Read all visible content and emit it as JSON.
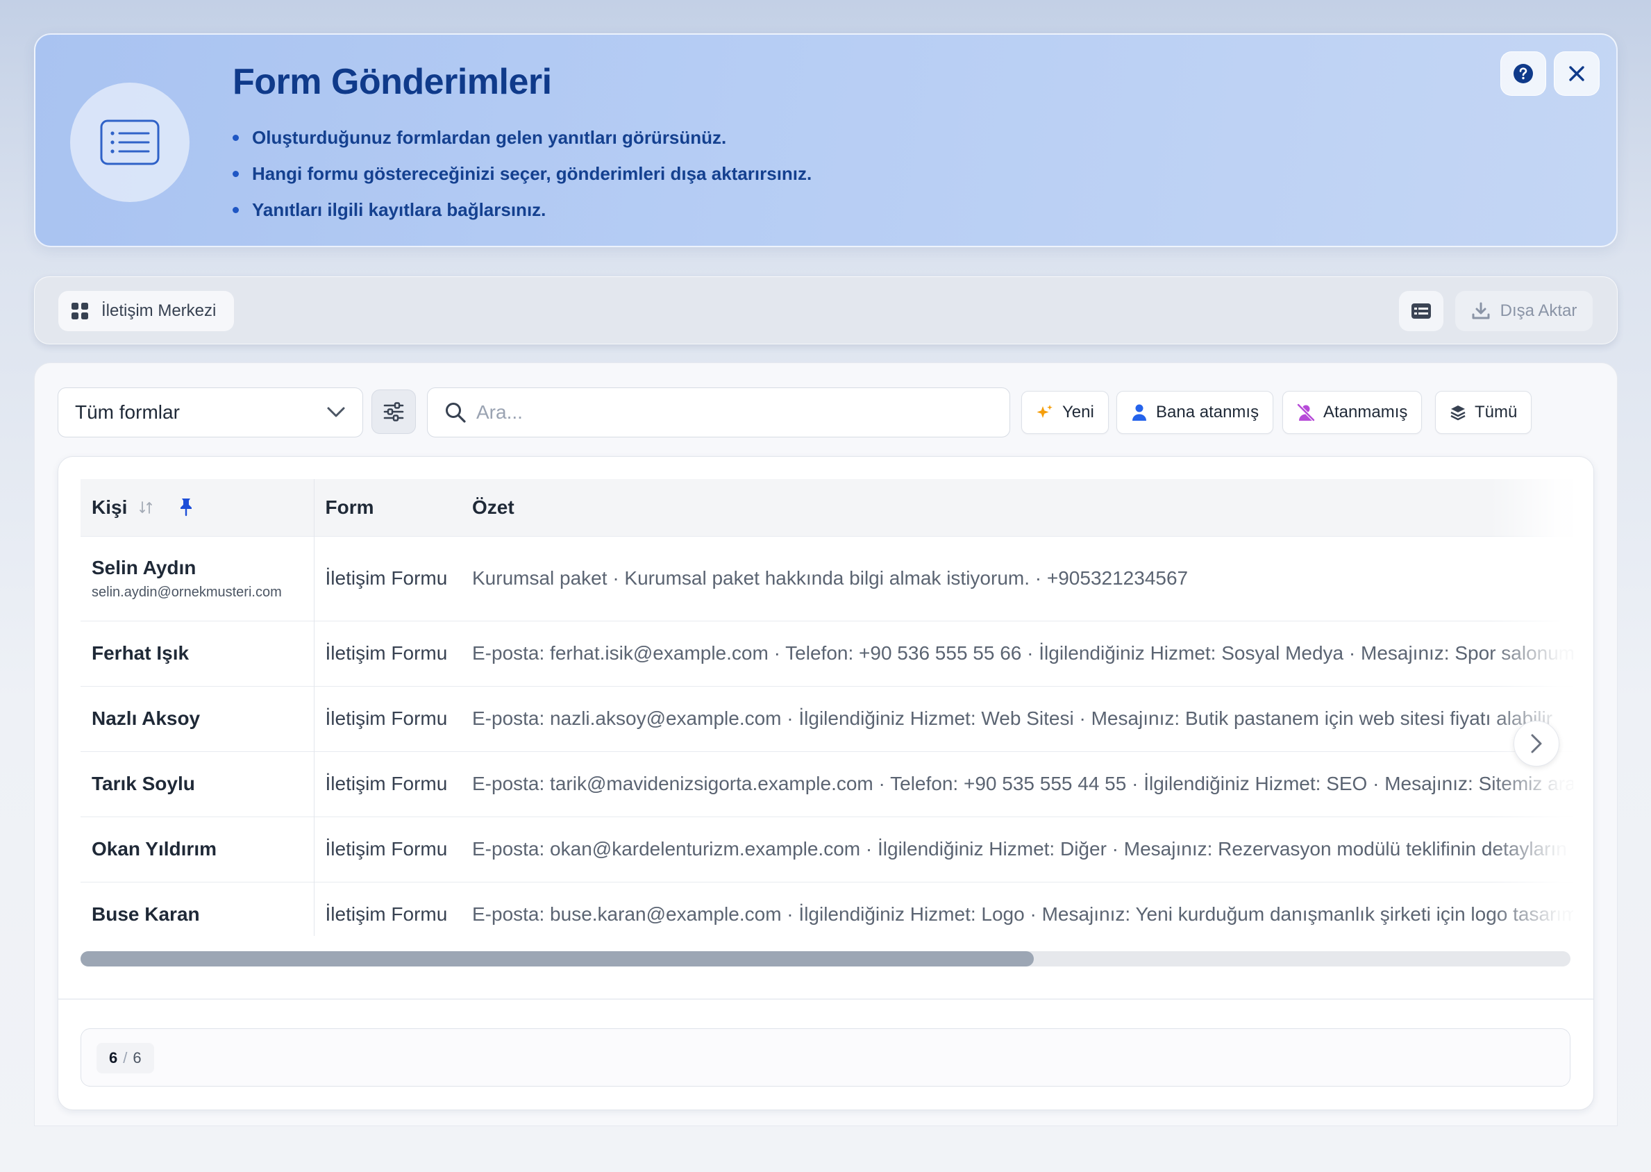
{
  "hero": {
    "title": "Form Gönderimleri",
    "bullets": [
      "Oluşturduğunuz formlardan gelen yanıtları görürsünüz.",
      "Hangi formu göstereceğinizi seçer, gönderimleri dışa aktarırsınız.",
      "Yanıtları ilgili kayıtlara bağlarsınız."
    ]
  },
  "toolbar": {
    "breadcrumb": "İletişim Merkezi",
    "export_label": "Dışa Aktar"
  },
  "filters": {
    "form_select": "Tüm formlar",
    "search_placeholder": "Ara...",
    "chips": {
      "new": "Yeni",
      "assigned_to_me": "Bana atanmış",
      "unassigned": "Atanmamış",
      "all": "Tümü"
    }
  },
  "table": {
    "headers": {
      "person": "Kişi",
      "form": "Form",
      "summary": "Özet"
    },
    "rows": [
      {
        "name": "Selin Aydın",
        "email": "selin.aydin@ornekmusteri.com",
        "form": "İletişim Formu",
        "summary": "Kurumsal paket · Kurumsal paket hakkında bilgi almak istiyorum. · +905321234567"
      },
      {
        "name": "Ferhat Işık",
        "email": "",
        "form": "İletişim Formu",
        "summary": "E-posta: ferhat.isik@example.com · Telefon: +90 536 555 55 66 · İlgilendiğiniz Hizmet: Sosyal Medya · Mesajınız: Spor salonum"
      },
      {
        "name": "Nazlı Aksoy",
        "email": "",
        "form": "İletişim Formu",
        "summary": "E-posta: nazli.aksoy@example.com · İlgilendiğiniz Hizmet: Web Sitesi · Mesajınız: Butik pastanem için web sitesi fiyatı alabilir"
      },
      {
        "name": "Tarık Soylu",
        "email": "",
        "form": "İletişim Formu",
        "summary": "E-posta: tarik@mavidenizsigorta.example.com · Telefon: +90 535 555 44 55 · İlgilendiğiniz Hizmet: SEO · Mesajınız: Sitemiz arama"
      },
      {
        "name": "Okan Yıldırım",
        "email": "",
        "form": "İletişim Formu",
        "summary": "E-posta: okan@kardelenturizm.example.com · İlgilendiğiniz Hizmet: Diğer · Mesajınız: Rezervasyon modülü teklifinin detayların"
      },
      {
        "name": "Buse Karan",
        "email": "",
        "form": "İletişim Formu",
        "summary": "E-posta: buse.karan@example.com · İlgilendiğiniz Hizmet: Logo · Mesajınız: Yeni kurduğum danışmanlık şirketi için logo tasarım"
      }
    ]
  },
  "pagination": {
    "shown": "6",
    "separator": "/",
    "total": "6"
  },
  "scroll": {
    "visible_fraction": 0.64
  },
  "colors": {
    "brand_blue": "#0f3a8a",
    "accent_blue": "#1f56c4",
    "new_chip_icon": "#f59e0b",
    "assigned_chip_icon": "#2563eb",
    "unassigned_chip_icon": "#b64ad8",
    "pin_icon": "#1d4ed8"
  },
  "icons": {
    "hero": "list-icon",
    "help": "help-icon",
    "close": "close-icon",
    "breadcrumb": "grid-icon",
    "view": "card-view-icon",
    "export": "download-icon",
    "select": "chevron-down-icon",
    "settings": "sliders-icon",
    "search": "search-icon",
    "new": "sparkles-icon",
    "assigned": "user-icon",
    "unassigned": "user-off-icon",
    "all": "layers-icon",
    "sort": "sort-icon",
    "pin": "pin-icon",
    "next": "chevron-right-icon"
  }
}
